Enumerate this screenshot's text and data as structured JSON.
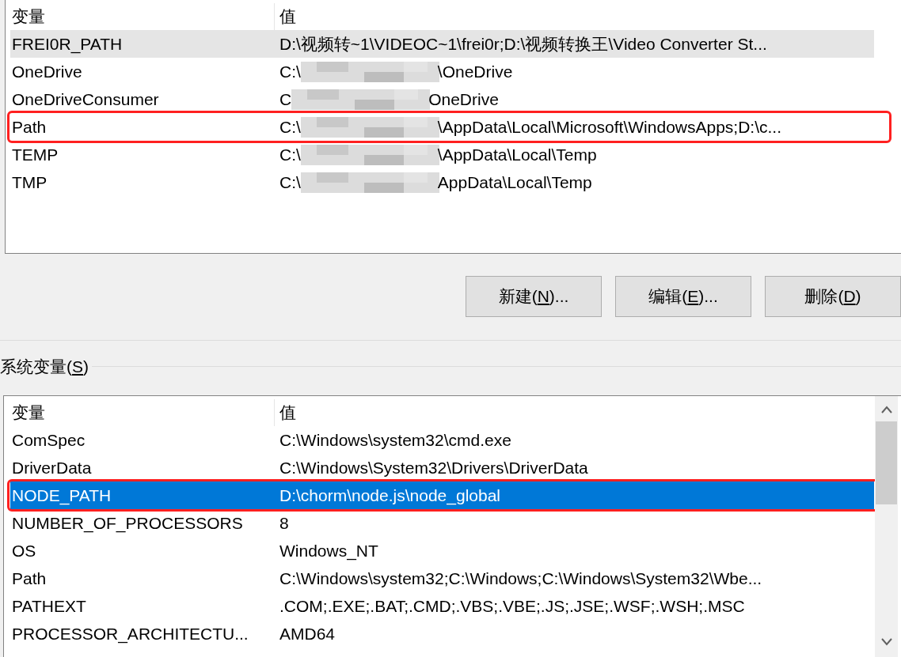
{
  "user_variables": {
    "focused": false,
    "columns": [
      "变量",
      "值"
    ],
    "rows": [
      {
        "name": "FREI0R_PATH",
        "value": "D:\\视频转~1\\VIDEOC~1\\frei0r;D:\\视频转换王\\Video Converter St...",
        "selected": true,
        "annotated": false
      },
      {
        "name": "OneDrive",
        "value_start": "C:\\",
        "value_end": "\\OneDrive",
        "selected": false,
        "annotated": false
      },
      {
        "name": "OneDriveConsumer",
        "value_start": "C",
        "value_end": "OneDrive",
        "selected": false,
        "annotated": false
      },
      {
        "name": "Path",
        "value_start": "C:\\",
        "value_end": "\\AppData\\Local\\Microsoft\\WindowsApps;D:\\c...",
        "selected": false,
        "annotated": true
      },
      {
        "name": "TEMP",
        "value_start": "C:\\",
        "value_end": "\\AppData\\Local\\Temp",
        "selected": false,
        "annotated": false
      },
      {
        "name": "TMP",
        "value_start": "C:\\",
        "value_end": "AppData\\Local\\Temp",
        "selected": false,
        "annotated": false
      }
    ]
  },
  "buttons": [
    {
      "before": "新建(",
      "key": "N",
      "after": ")..."
    },
    {
      "before": "编辑(",
      "key": "E",
      "after": ")..."
    },
    {
      "before": "删除(",
      "key": "D",
      "after": ")"
    }
  ],
  "system_variables": {
    "title_before": "系统变量(",
    "title_key": "S",
    "title_after": ")",
    "focused": true,
    "columns": [
      "变量",
      "值"
    ],
    "rows": [
      {
        "name": "ComSpec",
        "value": "C:\\Windows\\system32\\cmd.exe",
        "selected": false,
        "annotated": false
      },
      {
        "name": "DriverData",
        "value": "C:\\Windows\\System32\\Drivers\\DriverData",
        "selected": false,
        "annotated": false
      },
      {
        "name": "NODE_PATH",
        "value": "D:\\chorm\\node.js\\node_global",
        "selected": true,
        "annotated": true
      },
      {
        "name": "NUMBER_OF_PROCESSORS",
        "value": "8",
        "selected": false,
        "annotated": false
      },
      {
        "name": "OS",
        "value": "Windows_NT",
        "selected": false,
        "annotated": false
      },
      {
        "name": "Path",
        "value": "C:\\Windows\\system32;C:\\Windows;C:\\Windows\\System32\\Wbe...",
        "selected": false,
        "annotated": false
      },
      {
        "name": "PATHEXT",
        "value": ".COM;.EXE;.BAT;.CMD;.VBS;.VBE;.JS;.JSE;.WSF;.WSH;.MSC",
        "selected": false,
        "annotated": false
      },
      {
        "name": "PROCESSOR_ARCHITECTU...",
        "value": "AMD64",
        "selected": false,
        "annotated": false
      }
    ]
  }
}
